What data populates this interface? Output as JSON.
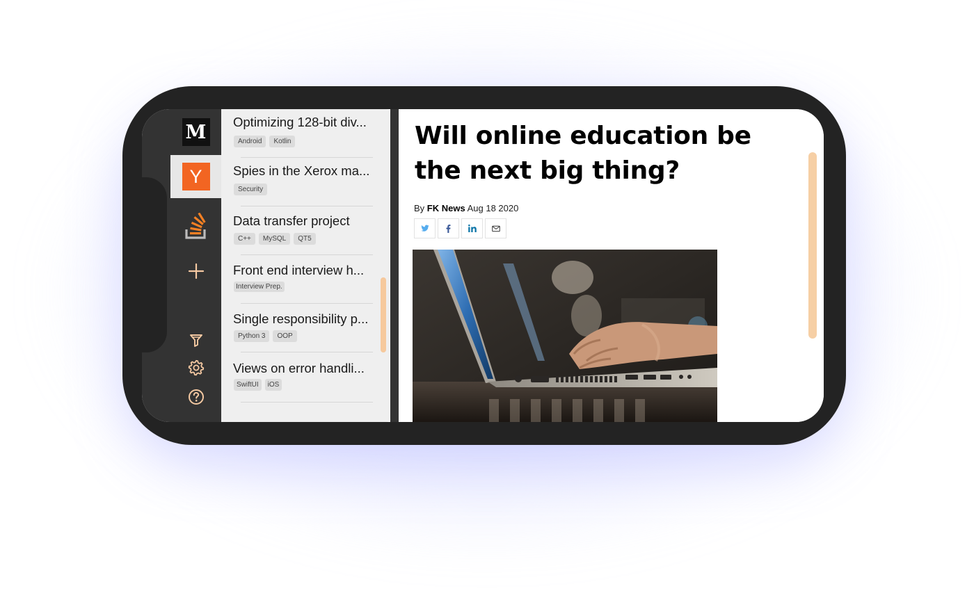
{
  "sources": [
    {
      "name": "medium",
      "glyph": "M",
      "active": false
    },
    {
      "name": "hacker-news",
      "glyph": "Y",
      "active": true
    },
    {
      "name": "stack-overflow",
      "glyph": "",
      "active": false
    },
    {
      "name": "add-source",
      "glyph": "+",
      "active": false
    }
  ],
  "tools": [
    "filter-icon",
    "settings-icon",
    "help-icon"
  ],
  "colors": {
    "accent": "#f6c99d",
    "hn_orange": "#f26522",
    "so_orange": "#f48024",
    "icon_peach": "#f5c9a2"
  },
  "list": {
    "items": [
      {
        "title": "Optimizing 128-bit div...",
        "tags": [
          "Android",
          "Kotlin"
        ]
      },
      {
        "title": "Spies in the Xerox ma...",
        "tags": [
          "Security"
        ]
      },
      {
        "title": "Data transfer project",
        "tags": [
          "C++",
          "MySQL",
          "QT5"
        ]
      },
      {
        "title": "Front end interview h...",
        "tags": [
          "Interview Prep."
        ]
      },
      {
        "title": "Single responsibility p...",
        "tags": [
          "Python 3",
          "OOP"
        ]
      },
      {
        "title": "Views on error handli...",
        "tags": [
          "SwiftUI",
          "iOS"
        ]
      }
    ]
  },
  "article": {
    "headline": "Will online education be the next big thing?",
    "by_prefix": "By",
    "author": "FK News",
    "date": "Aug 18 2020",
    "share": [
      "twitter-icon",
      "facebook-icon",
      "linkedin-icon",
      "mail-icon"
    ]
  }
}
